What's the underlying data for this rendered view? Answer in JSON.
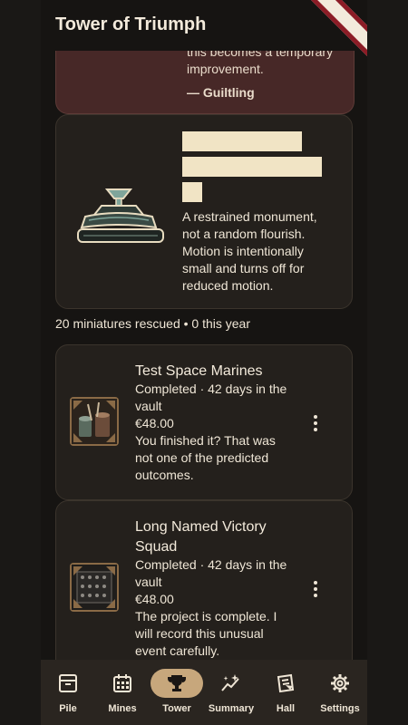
{
  "app": {
    "title": "Tower of Triumph"
  },
  "quote": {
    "text": "this becomes a temporary improvement.",
    "author": "— Guiltling"
  },
  "monument": {
    "description": "A restrained monument, not a random flourish. Motion is intentionally small and turns off for reduced motion."
  },
  "stats": {
    "line": "20 miniatures rescued • 0 this year"
  },
  "projects": [
    {
      "title": "Test Space Marines",
      "status": "Completed · 42 days in the vault",
      "price": "€48.00",
      "note": "You finished it? That was not one of the predicted outcomes.",
      "thumbnail_icon": "paint-pots-icon"
    },
    {
      "title": "Long Named Victory Squad",
      "status": "Completed · 42 days in the vault",
      "price": "€48.00",
      "note": "The project is complete. I will record this unusual event carefully.",
      "thumbnail_icon": "miniature-sprue-icon"
    }
  ],
  "nav": {
    "items": [
      {
        "label": "Pile",
        "icon": "archive-box-icon"
      },
      {
        "label": "Mines",
        "icon": "calendar-grid-icon"
      },
      {
        "label": "Tower",
        "icon": "trophy-icon",
        "active": true
      },
      {
        "label": "Summary",
        "icon": "sparkle-chart-icon"
      },
      {
        "label": "Hall",
        "icon": "ticket-hall-icon"
      },
      {
        "label": "Settings",
        "icon": "gear-icon"
      }
    ]
  },
  "colors": {
    "background": "#161412",
    "card": "#24201c",
    "quote_card": "#472827",
    "active_nav": "#c7a77c",
    "text": "#efe6d6"
  }
}
